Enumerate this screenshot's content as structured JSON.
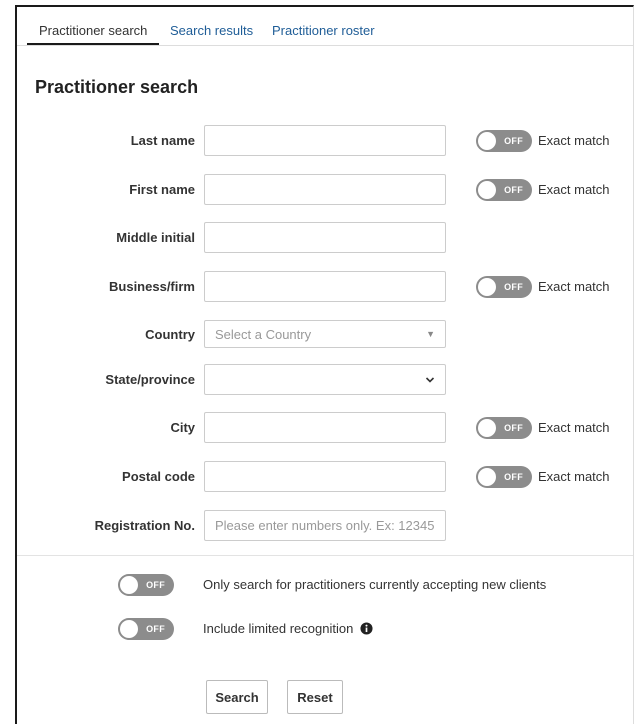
{
  "tabs": [
    {
      "label": "Practitioner search",
      "active": true
    },
    {
      "label": "Search results",
      "active": false
    },
    {
      "label": "Practitioner roster",
      "active": false
    }
  ],
  "page_title": "Practitioner search",
  "toggle_off_label": "OFF",
  "exact_match_label": "Exact match",
  "form": {
    "last_name": {
      "label": "Last name",
      "value": ""
    },
    "first_name": {
      "label": "First name",
      "value": ""
    },
    "middle_initial": {
      "label": "Middle initial",
      "value": ""
    },
    "business": {
      "label": "Business/firm",
      "value": ""
    },
    "country": {
      "label": "Country",
      "placeholder": "Select a Country"
    },
    "state": {
      "label": "State/province",
      "value": ""
    },
    "city": {
      "label": "City",
      "value": ""
    },
    "postal": {
      "label": "Postal code",
      "value": ""
    },
    "registration": {
      "label": "Registration No.",
      "placeholder": "Please enter numbers only. Ex: 12345"
    }
  },
  "options": {
    "accepting_clients": "Only search for practitioners currently accepting new clients",
    "limited_recognition": "Include limited recognition"
  },
  "buttons": {
    "search": "Search",
    "reset": "Reset"
  },
  "colors": {
    "tab_link": "#1f5d97",
    "toggle_off_bg": "#8c8c8c"
  },
  "icons": {
    "info": "info-circle-icon",
    "state_dropdown": "chevron-down-icon",
    "country_dropdown": "caret-down-icon"
  }
}
